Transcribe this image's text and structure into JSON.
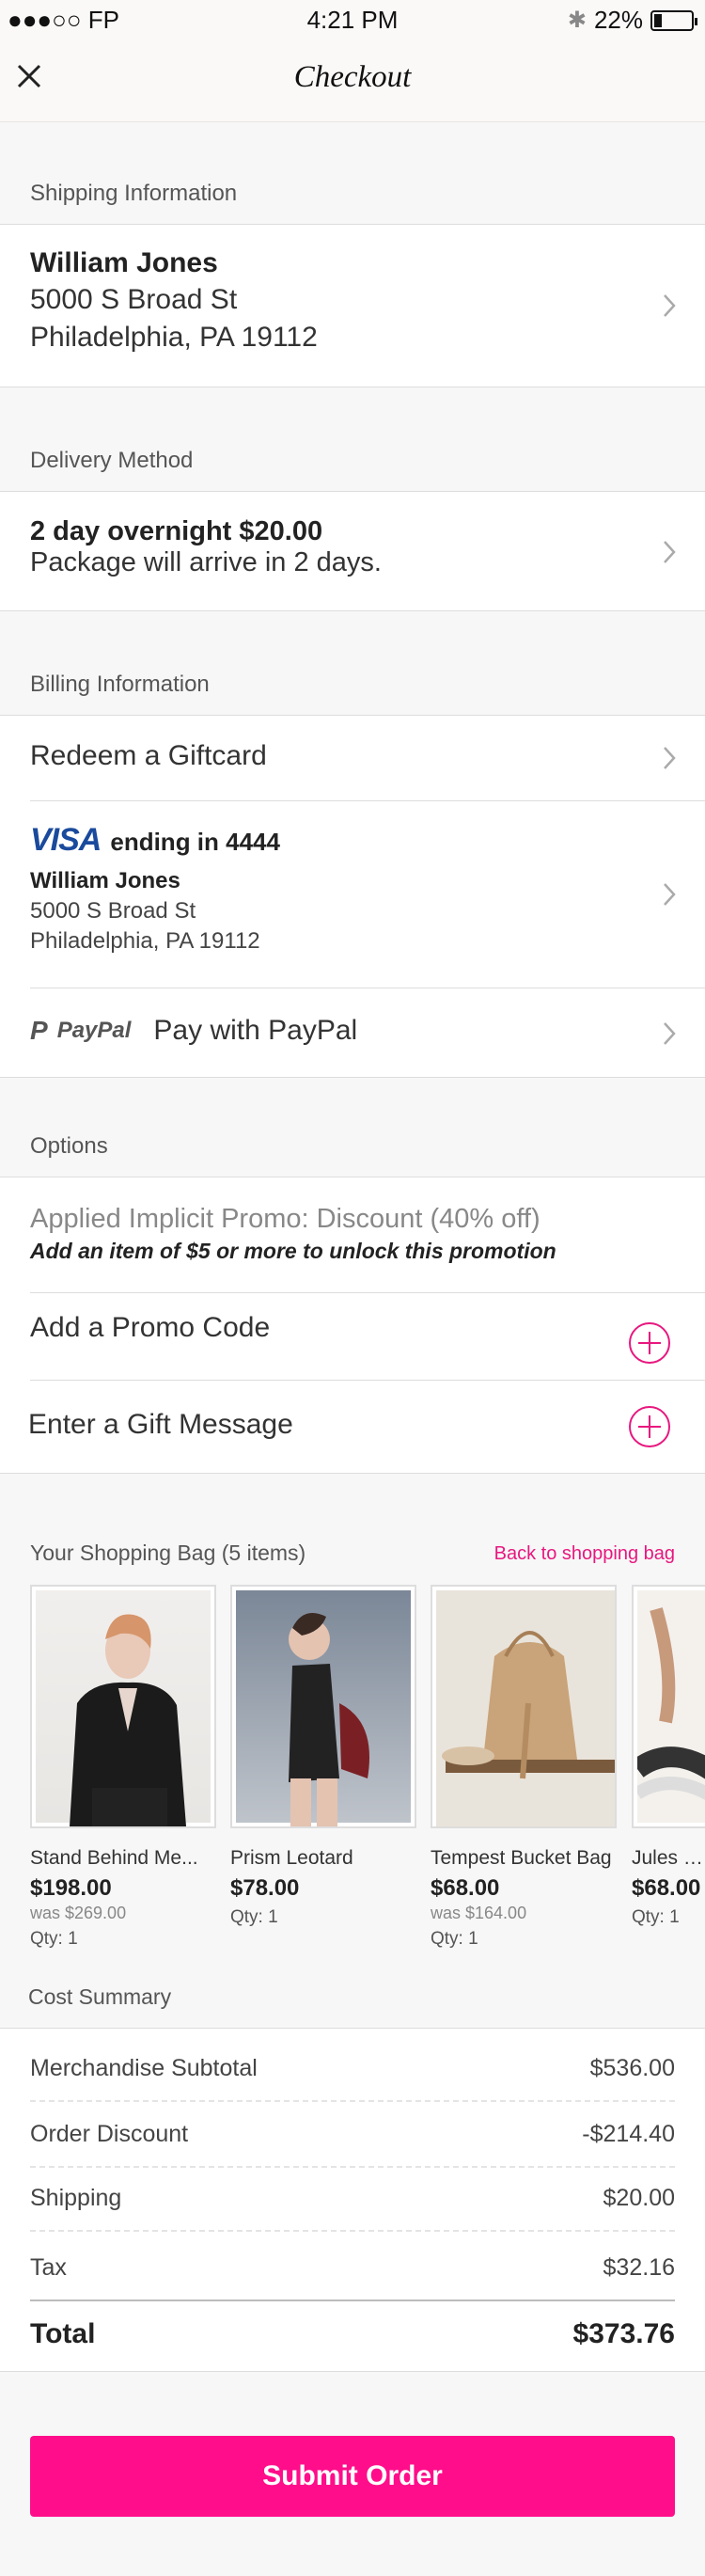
{
  "status_bar": {
    "carrier": "●●●○○ FP",
    "time": "4:21 PM",
    "battery": "22%",
    "battery_level": 0.22
  },
  "nav": {
    "title": "Checkout"
  },
  "shipping": {
    "label": "Shipping Information",
    "name": "William Jones",
    "street": "5000 S Broad St",
    "city": "Philadelphia, PA 19112"
  },
  "delivery": {
    "label": "Delivery Method",
    "method": "2 day overnight $20.00",
    "note": "Package will arrive in 2 days."
  },
  "billing": {
    "label": "Billing Information",
    "giftcard": "Redeem a Giftcard",
    "card_brand": "VISA",
    "card_text": "ending in 4444",
    "card_name": "William Jones",
    "card_street": "5000 S Broad St",
    "card_city": "Philadelphia, PA 19112",
    "paypal_logo": "PayPal",
    "paypal_label": "Pay with PayPal"
  },
  "options": {
    "label": "Options",
    "promo_title": "Applied Implicit Promo: Discount (40% off)",
    "promo_note": "Add an item of $5 or more to unlock this promotion",
    "promo_code": "Add a Promo Code",
    "gift_message": "Enter a Gift Message"
  },
  "bag": {
    "title": "Your Shopping Bag (5 items)",
    "back_link": "Back to shopping bag",
    "items": [
      {
        "name": "Stand Behind Me...",
        "price": "$198.00",
        "was": "was $269.00",
        "qty": "Qty: 1"
      },
      {
        "name": "Prism Leotard",
        "price": "$78.00",
        "was": "",
        "qty": "Qty: 1"
      },
      {
        "name": "Tempest Bucket Bag",
        "price": "$68.00",
        "was": "was $164.00",
        "qty": "Qty: 1"
      },
      {
        "name": "Jules Ca",
        "price": "$68.00",
        "was": "",
        "qty": "Qty: 1"
      }
    ]
  },
  "cost": {
    "label": "Cost Summary",
    "rows": [
      {
        "label": "Merchandise Subtotal",
        "value": "$536.00"
      },
      {
        "label": "Order Discount",
        "value": "-$214.40"
      },
      {
        "label": "Shipping",
        "value": "$20.00"
      },
      {
        "label": "Tax",
        "value": "$32.16"
      }
    ],
    "total_label": "Total",
    "total_value": "$373.76"
  },
  "submit_label": "Submit Order",
  "colors": {
    "accent": "#ff0d8a",
    "link": "#e8177f",
    "visa": "#1a4a9c"
  }
}
